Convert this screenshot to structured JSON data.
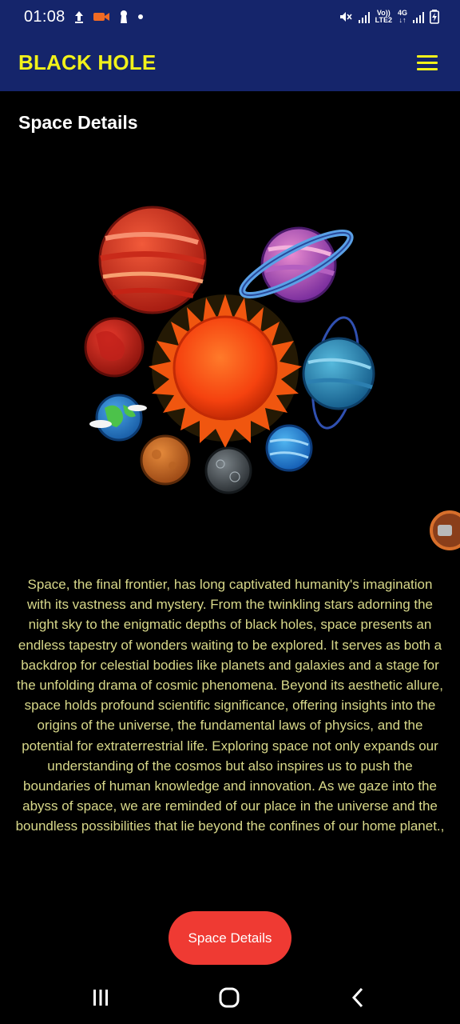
{
  "status_bar": {
    "time": "01:08",
    "network_top": "Vo))",
    "network_bottom": "LTE2",
    "data_top": "4G",
    "data_bottom": "↓↑"
  },
  "app_bar": {
    "title": "BLACK HOLE",
    "menu_icon": "hamburger-menu-icon"
  },
  "page": {
    "heading": "Space Details",
    "hero_image": "solar-system-illustration",
    "description": "Space, the final frontier, has long captivated humanity's imagination with its vastness and mystery. From the twinkling stars adorning the night sky to the enigmatic depths of black holes, space presents an endless tapestry of wonders waiting to be explored. It serves as both a backdrop for celestial bodies like planets and galaxies and a stage for the unfolding drama of cosmic phenomena. Beyond its aesthetic allure, space holds profound scientific significance, offering insights into the origins of the universe, the fundamental laws of physics, and the potential for extraterrestrial life. Exploring space not only expands our understanding of the cosmos but also inspires us to push the boundaries of human knowledge and innovation. As we gaze into the abyss of space, we are reminded of our place in the universe and the boundless possibilities that lie beyond the confines of our home planet.,",
    "button_label": "Space Details"
  },
  "colors": {
    "app_bar": "#15256b",
    "title": "#f2f21a",
    "body_text": "#d8d88a",
    "button": "#ef3a33",
    "background": "#000000"
  },
  "nav_bar": {
    "recents_icon": "recents-icon",
    "home_icon": "home-icon",
    "back_icon": "back-icon"
  }
}
